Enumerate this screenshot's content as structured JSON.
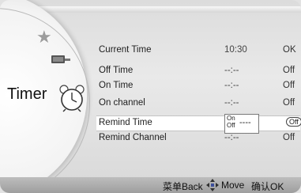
{
  "menu": {
    "title": "Timer",
    "rows": [
      {
        "label": "Current Time",
        "time": "10:30",
        "state": "OK"
      },
      {
        "label": "Off Time",
        "time": "--:--",
        "state": "Off"
      },
      {
        "label": "On Time",
        "time": "--:--",
        "state": "Off"
      },
      {
        "label": "On channel",
        "time": "--:--",
        "state": "Off"
      },
      {
        "label": "Remind Time",
        "time": "----",
        "state": "Off",
        "dropdown_options": [
          "On",
          "Off"
        ]
      },
      {
        "label": "Remind Channel",
        "time": "--:--",
        "state": "Off"
      }
    ]
  },
  "footer": {
    "back": "菜单Back",
    "move": "Move",
    "ok": "确认OK"
  },
  "icons": {
    "sidebar": [
      "star-icon",
      "remote-icon",
      "alarm-clock-icon"
    ],
    "move": "dpad-arrows-icon"
  }
}
